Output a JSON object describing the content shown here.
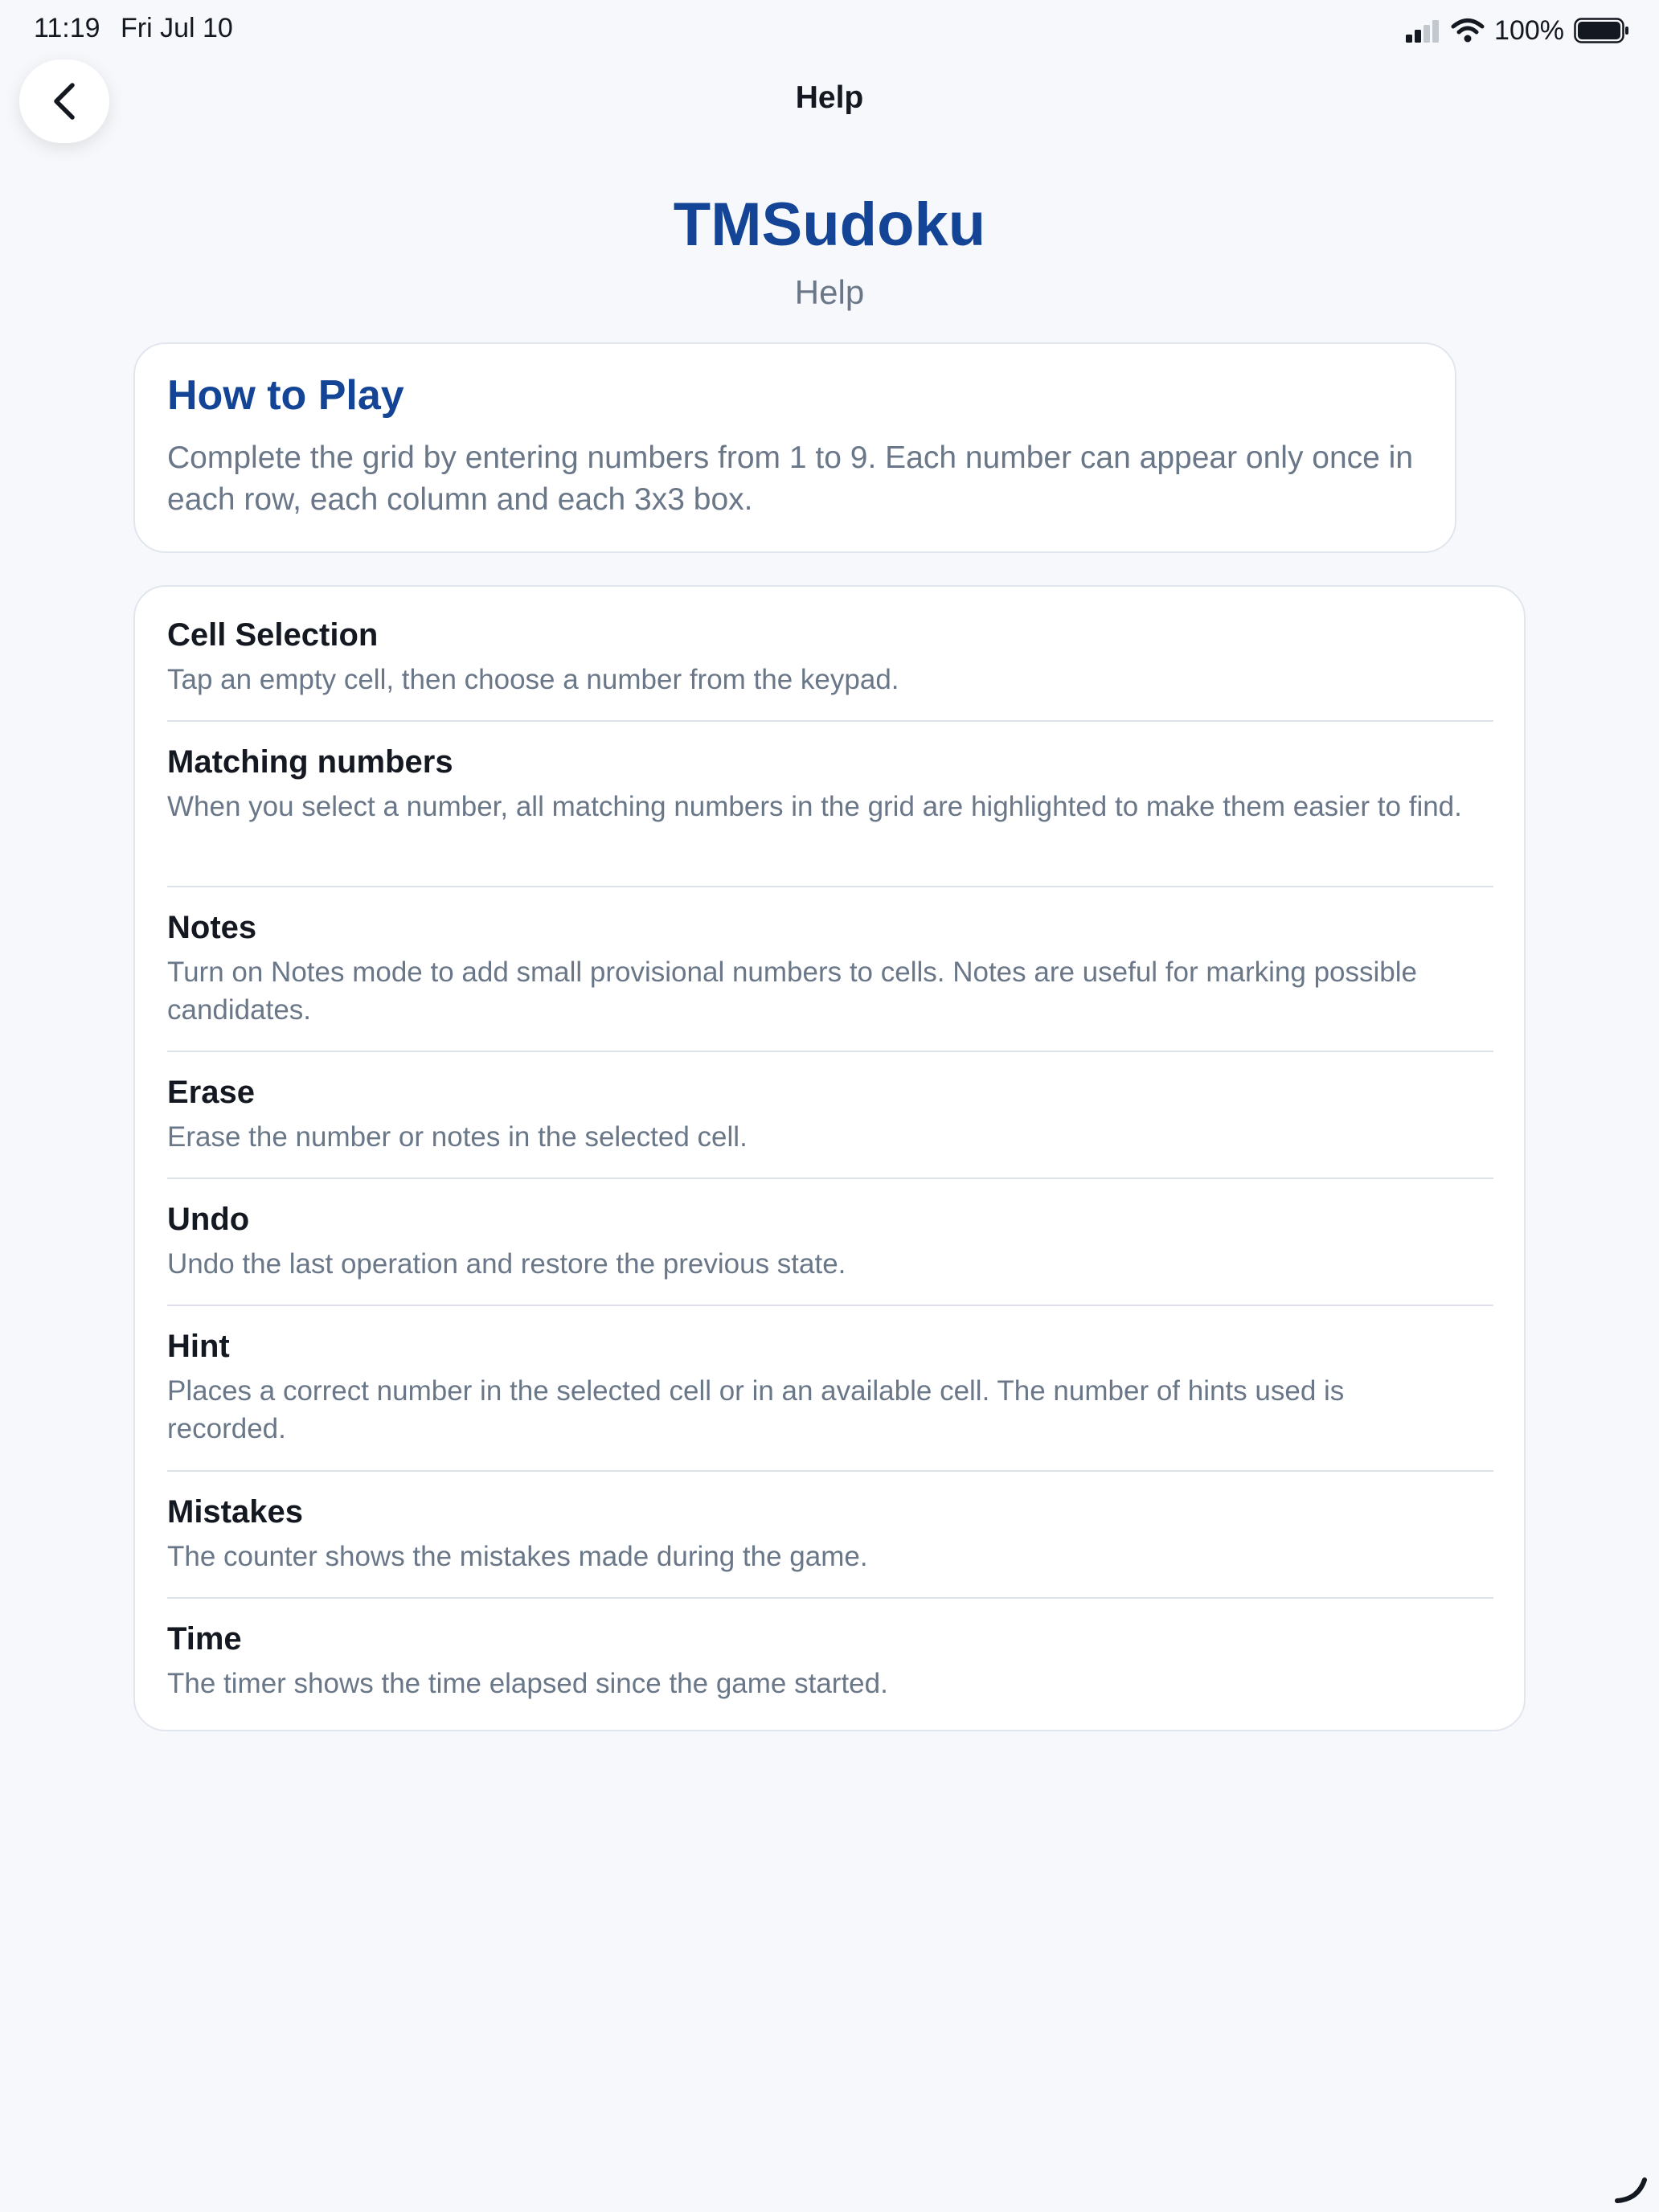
{
  "status_bar": {
    "time": "11:19",
    "date": "Fri Jul 10",
    "battery_percent": "100%",
    "icons": [
      "cellular-signal-icon",
      "wifi-icon",
      "battery-icon"
    ]
  },
  "nav": {
    "title": "Help",
    "back_icon": "chevron-left-icon"
  },
  "header": {
    "app_title": "TMSudoku",
    "subtitle": "Help"
  },
  "how_to_play": {
    "title": "How to Play",
    "text": "Complete the grid by entering numbers from 1 to 9. Each number can appear only once in each row, each column and each 3x3 box."
  },
  "features": [
    {
      "title": "Cell Selection",
      "description": "Tap an empty cell, then choose a number from the keypad."
    },
    {
      "title": "Matching numbers",
      "description": "When you select a number, all matching numbers in the grid are highlighted to make them easier to find."
    },
    {
      "title": "Notes",
      "description": "Turn on Notes mode to add small provisional numbers to cells. Notes are useful for marking possible candidates."
    },
    {
      "title": "Erase",
      "description": "Erase the number or notes in the selected cell."
    },
    {
      "title": "Undo",
      "description": "Undo the last operation and restore the previous state."
    },
    {
      "title": "Hint",
      "description": "Places a correct number in the selected cell or in an available cell. The number of hints used is recorded."
    },
    {
      "title": "Mistakes",
      "description": "The counter shows the mistakes made during the game."
    },
    {
      "title": "Time",
      "description": "The timer shows the time elapsed since the game started."
    }
  ],
  "colors": {
    "accent": "#134495",
    "background": "#f6f8fb",
    "card": "#ffffff",
    "secondary_text": "#6a7788",
    "primary_text": "#141820"
  }
}
